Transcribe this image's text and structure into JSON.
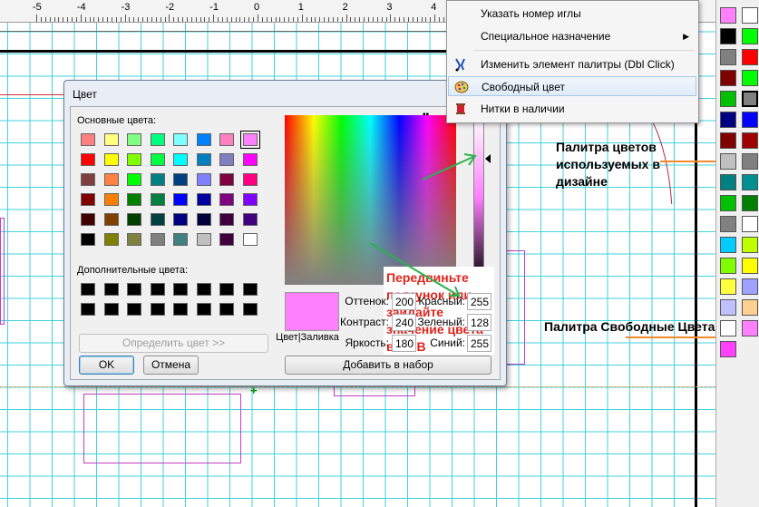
{
  "ruler": {
    "labels": [
      "-5",
      "-4",
      "-3",
      "-2",
      "-1",
      "0",
      "1",
      "2",
      "3",
      "4"
    ]
  },
  "dialog": {
    "title": "Цвет",
    "basic_colors_label": "Основные цвета:",
    "custom_colors_label": "Дополнительные цвета:",
    "define_button": "Определить цвет >>",
    "ok_button": "OK",
    "cancel_button": "Отмена",
    "add_button": "Добавить в набор",
    "color_fill_label": "Цвет|Заливка",
    "hue_label": "Оттенок:",
    "hue_value": "200",
    "sat_label": "Контраст:",
    "sat_value": "240",
    "lum_label": "Яркость:",
    "lum_value": "180",
    "red_label": "Красный:",
    "red_value": "255",
    "green_label": "Зеленый:",
    "green_value": "128",
    "blue_label": "Синий:",
    "blue_value": "255",
    "basic_colors": [
      [
        "#ff8080",
        "#ffff80",
        "#80ff80",
        "#00ff80",
        "#80ffff",
        "#0080ff",
        "#ff80c0",
        "#ff80ff"
      ],
      [
        "#ff0000",
        "#ffff00",
        "#80ff00",
        "#00ff40",
        "#00ffff",
        "#0080c0",
        "#8080c0",
        "#ff00ff"
      ],
      [
        "#804040",
        "#ff8040",
        "#00ff00",
        "#008080",
        "#004080",
        "#8080ff",
        "#800040",
        "#ff0080"
      ],
      [
        "#800000",
        "#ff8000",
        "#008000",
        "#008040",
        "#0000ff",
        "#0000a0",
        "#800080",
        "#8000ff"
      ],
      [
        "#400000",
        "#804000",
        "#004000",
        "#004040",
        "#000080",
        "#000040",
        "#400040",
        "#400080"
      ],
      [
        "#000000",
        "#808000",
        "#808040",
        "#808080",
        "#408080",
        "#c0c0c0",
        "#400040",
        "#ffffff"
      ]
    ],
    "custom_colors": [
      [
        "#000000",
        "#000000",
        "#000000",
        "#000000",
        "#000000",
        "#000000",
        "#000000",
        "#000000"
      ],
      [
        "#000000",
        "#000000",
        "#000000",
        "#000000",
        "#000000",
        "#000000",
        "#000000",
        "#000000"
      ]
    ],
    "selected_color": "#ff80ff"
  },
  "annotation": {
    "slider_note": "Передвиньте ползунок или зайдайте значение цвета в RGB",
    "design_palette": "Палитра цветов используемых в дизайне",
    "free_palette": "Палитра Свободные Цвета"
  },
  "menu": {
    "items": [
      {
        "label": "Указать номер иглы",
        "icon": ""
      },
      {
        "label": "Специальное назначение",
        "icon": "submenu-arrow"
      },
      {
        "label": "Изменить элемент палитры (Dbl Click)",
        "icon": "tools-icon"
      },
      {
        "label": "Свободный цвет",
        "icon": "palette-icon"
      },
      {
        "label": "Нитки в наличии",
        "icon": "thread-spool-icon"
      }
    ]
  },
  "palette": {
    "colors": [
      "#ff80ff",
      "#ffffff",
      "#000000",
      "#00ff00",
      "#808080",
      "#ff0000",
      "#800000",
      "#00ff00",
      "#00c000",
      "#808080",
      "#000080",
      "#0000ff",
      "#800000",
      "#a00000",
      "#c0c0c0",
      "#808080",
      "#008080",
      "#009090",
      "#00c000",
      "#008000",
      "#808080",
      "#ffffff",
      "#00ccff",
      "#c0ff00",
      "#80ff00",
      "#ffff00",
      "#ffff40",
      "#a0a0ff",
      "#c0c0ff",
      "#ffd090",
      "#ffffff",
      "#ff80ff",
      "#ff40ff"
    ]
  }
}
